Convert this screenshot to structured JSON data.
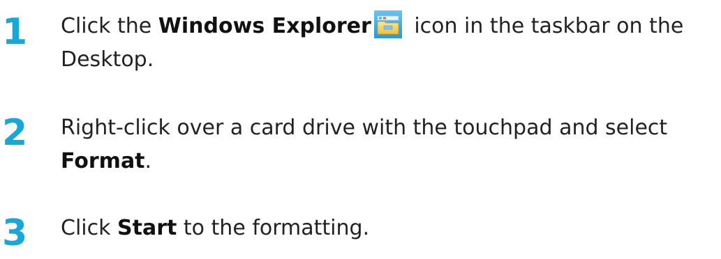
{
  "steps": [
    {
      "number": "1",
      "pre": "Click the ",
      "bold": "Windows Explorer",
      "icon": "windows-explorer-folder-icon",
      "post": " icon in the taskbar on the Desktop."
    },
    {
      "number": "2",
      "pre": "Right-click over a card drive with the touchpad and select ",
      "bold": "Format",
      "post": "."
    },
    {
      "number": "3",
      "pre": "Click ",
      "bold": "Start",
      "post": " to the formatting."
    }
  ],
  "colors": {
    "step_number": "#1aa7d6",
    "icon_folder": "#f2c94c",
    "icon_window": "#5fb7e8"
  }
}
